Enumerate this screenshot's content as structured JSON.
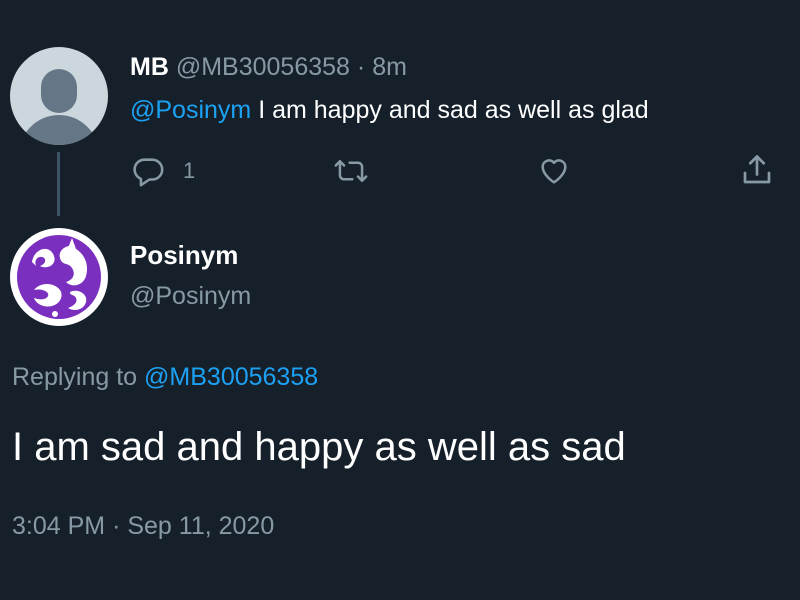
{
  "parent_tweet": {
    "author_name": "MB",
    "author_handle": "@MB30056358",
    "separator": "·",
    "time_ago": "8m",
    "mention": "@Posinym",
    "text": " I am happy and sad as well as glad",
    "avatar_icon": "default-profile-icon",
    "actions": {
      "reply_icon": "reply-icon",
      "reply_count": "1",
      "retweet_icon": "retweet-icon",
      "like_icon": "heart-icon",
      "share_icon": "share-icon"
    }
  },
  "main_tweet": {
    "author_name": "Posinym",
    "author_handle": "@Posinym",
    "avatar_icon": "posinym-cat-logo-icon",
    "replying_label": "Replying to ",
    "replying_handle": "@MB30056358",
    "text": "I am sad and happy as well as sad",
    "time": "3:04 PM",
    "separator": "·",
    "date": "Sep 11, 2020"
  },
  "colors": {
    "background": "#15202b",
    "accent": "#1da1f2",
    "muted": "#8899a6",
    "thread_line": "#3d5466",
    "avatar_purple": "#7b2fbe"
  }
}
